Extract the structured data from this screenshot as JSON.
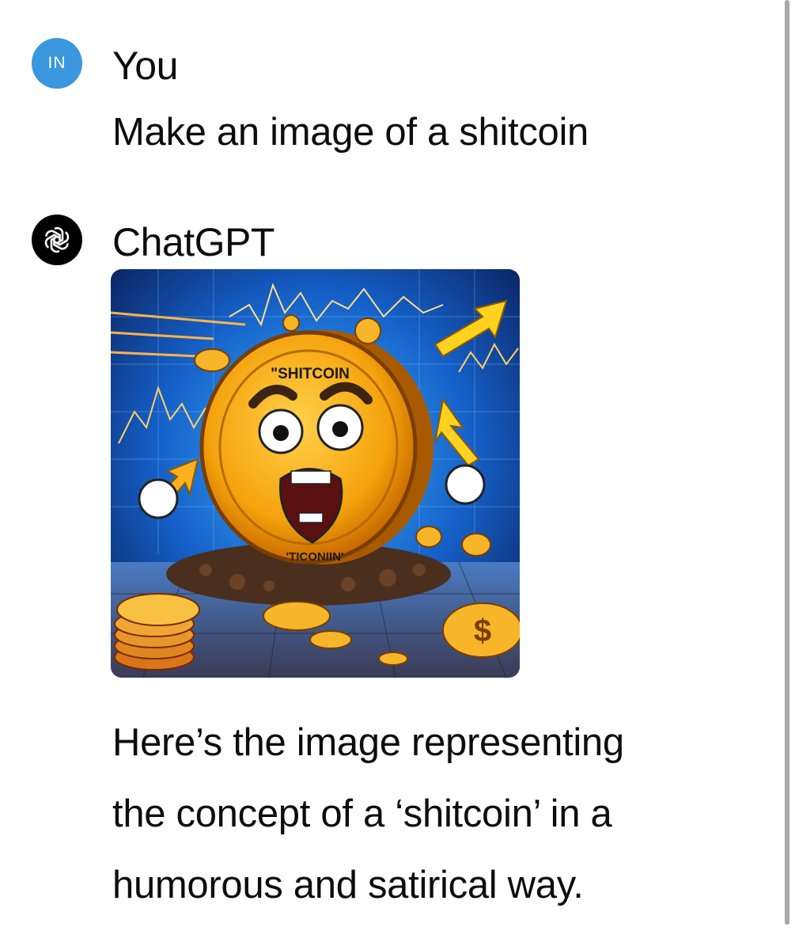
{
  "conversation": {
    "user": {
      "avatar_initials": "IN",
      "name": "You",
      "message": "Make an image of a shitcoin"
    },
    "assistant": {
      "avatar_icon": "openai-logo-icon",
      "name": "ChatGPT",
      "image": {
        "coin_label_top": "\"SHITCOIN",
        "coin_label_bottom": "'TICONIIN'"
      },
      "reply_lines": [
        "Here’s the image representing",
        "the concept of a ‘shitcoin’ in a",
        "humorous and satirical way."
      ]
    }
  },
  "colors": {
    "user_avatar": "#3a97dd",
    "bot_avatar": "#000000",
    "text": "#0d0d0d",
    "scrollbar": "#a9a9a9"
  }
}
